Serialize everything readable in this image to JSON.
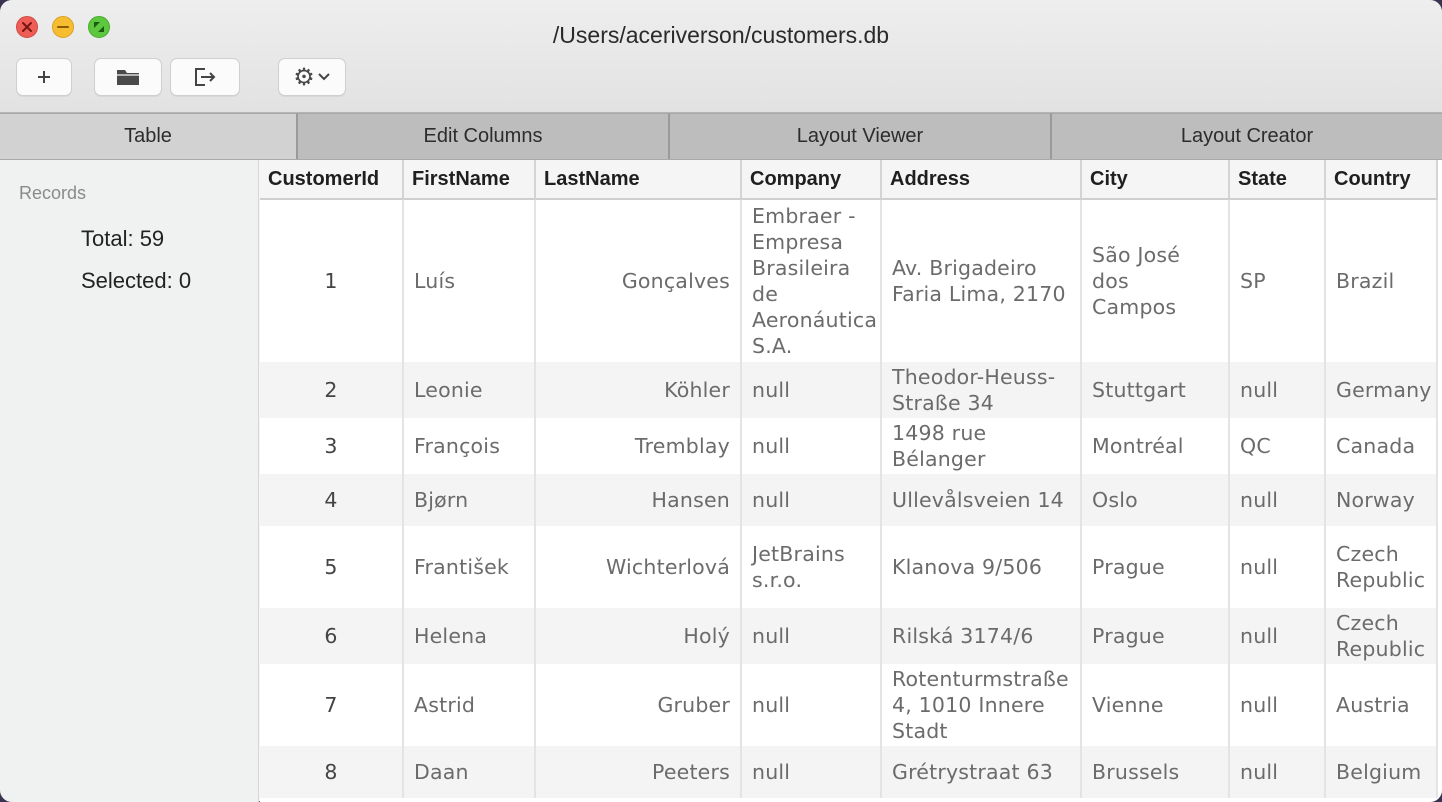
{
  "window": {
    "title": "/Users/aceriverson/customers.db"
  },
  "toolbar": {
    "buttons": [
      {
        "name": "add-button",
        "icon": "plus-icon",
        "glyph": "+"
      },
      {
        "name": "open-button",
        "icon": "folder-icon"
      },
      {
        "name": "export-button",
        "icon": "exit-icon"
      },
      {
        "name": "settings-button",
        "icon": "gear-icon",
        "glyph": "⚙"
      }
    ]
  },
  "tabs": [
    {
      "label": "Table",
      "active": true
    },
    {
      "label": "Edit Columns",
      "active": false
    },
    {
      "label": "Layout Viewer",
      "active": false
    },
    {
      "label": "Layout Creator",
      "active": false
    }
  ],
  "sidebar": {
    "heading": "Records",
    "total": "Total: 59",
    "selected": "Selected: 0"
  },
  "table": {
    "columns": [
      "CustomerId",
      "FirstName",
      "LastName",
      "Company",
      "Address",
      "City",
      "State",
      "Country"
    ],
    "rows": [
      [
        "1",
        "Luís",
        "Gonçalves",
        "Embraer - Empresa Brasileira de Aeronáutica S.A.",
        "Av. Brigadeiro Faria Lima, 2170",
        "São José dos Campos",
        "SP",
        "Brazil"
      ],
      [
        "2",
        "Leonie",
        "Köhler",
        "null",
        "Theodor-Heuss-Straße 34",
        "Stuttgart",
        "null",
        "Germany"
      ],
      [
        "3",
        "François",
        "Tremblay",
        "null",
        "1498 rue Bélanger",
        "Montréal",
        "QC",
        "Canada"
      ],
      [
        "4",
        "Bjørn",
        "Hansen",
        "null",
        "Ullevålsveien 14",
        "Oslo",
        "null",
        "Norway"
      ],
      [
        "5",
        "František",
        "Wichterlová",
        "JetBrains s.r.o.",
        "Klanova 9/506",
        "Prague",
        "null",
        "Czech Republic"
      ],
      [
        "6",
        "Helena",
        "Holý",
        "null",
        "Rilská 3174/6",
        "Prague",
        "null",
        "Czech Republic"
      ],
      [
        "7",
        "Astrid",
        "Gruber",
        "null",
        "Rotenturmstraße 4, 1010 Innere Stadt",
        "Vienne",
        "null",
        "Austria"
      ],
      [
        "8",
        "Daan",
        "Peeters",
        "null",
        "Grétrystraat 63",
        "Brussels",
        "null",
        "Belgium"
      ]
    ]
  }
}
